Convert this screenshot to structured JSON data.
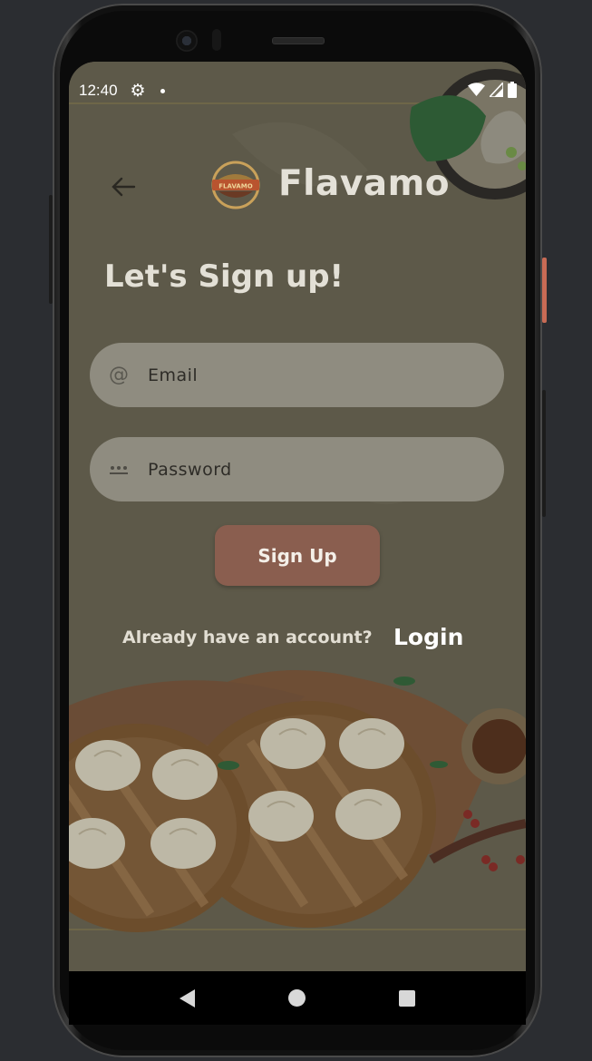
{
  "status_bar": {
    "time": "12:40"
  },
  "header": {
    "brand": "Flavamo",
    "logo_text": "FLAVAMO"
  },
  "form": {
    "title": "Let's Sign up!",
    "email_placeholder": "Email",
    "password_placeholder": "Password",
    "email_icon_glyph": "@",
    "submit_label": "Sign Up",
    "already_text": "Already have an account?",
    "login_label": "Login"
  },
  "colors": {
    "screen_overlay": "#5b5747",
    "field_bg": "#8f8c80",
    "button_bg": "#8a5e4f",
    "accent_side_button": "#c86b55"
  },
  "icons": {
    "back": "arrow-left-icon",
    "settings": "gear-icon",
    "wifi": "wifi-icon",
    "signal": "signal-icon",
    "battery": "battery-icon",
    "email": "at-sign-icon",
    "password": "password-dots-icon"
  }
}
